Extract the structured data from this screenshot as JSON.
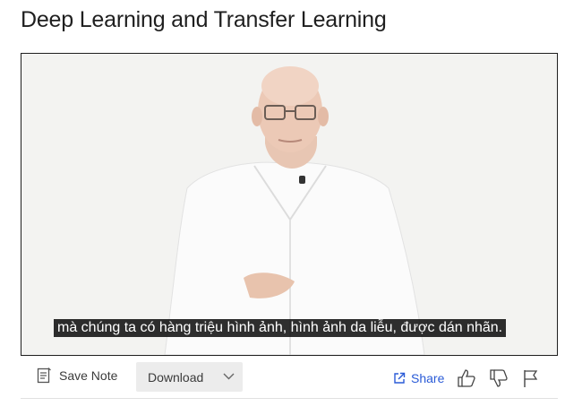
{
  "page": {
    "title": "Deep Learning and Transfer Learning"
  },
  "video": {
    "caption": "mà chúng ta có hàng triệu hình ảnh, hình ảnh da liễu, được dán nhãn."
  },
  "toolbar": {
    "save_note_label": "Save Note",
    "download_label": "Download",
    "share_label": "Share",
    "icons": {
      "save_note": "note-icon",
      "download": "chevron-down-icon",
      "share": "share-icon",
      "like": "thumbs-up-icon",
      "dislike": "thumbs-down-icon",
      "flag": "flag-icon"
    }
  },
  "colors": {
    "accent": "#2a5bd7",
    "caption_bg": "#000000",
    "text": "#1f1f1f"
  }
}
